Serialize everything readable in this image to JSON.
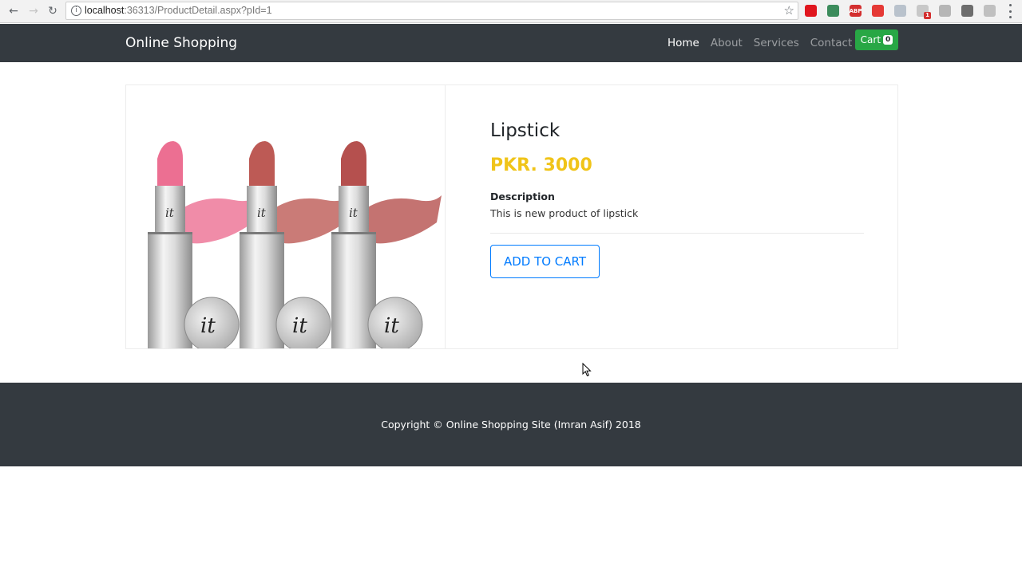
{
  "browser": {
    "url_host": "localhost",
    "url_rest": ":36313/ProductDetail.aspx?pId=1",
    "extensions": [
      {
        "name": "opera-icon",
        "color": "#e0161e"
      },
      {
        "name": "eyedropper-icon",
        "color": "#3c8c5c"
      },
      {
        "name": "adblock-icon",
        "color": "#d32f2f",
        "label": "ABP"
      },
      {
        "name": "video-icon",
        "color": "#e53935"
      },
      {
        "name": "dropbox-icon",
        "color": "#b9c2cc"
      },
      {
        "name": "extension-badge-icon",
        "color": "#c8c8c8",
        "badge": "1"
      },
      {
        "name": "angular-icon",
        "color": "#b6b6b6"
      },
      {
        "name": "a-icon",
        "color": "#6d6d6d"
      },
      {
        "name": "pdf-icon",
        "color": "#c0c0c0"
      }
    ]
  },
  "navbar": {
    "brand": "Online Shopping",
    "links": [
      {
        "label": "Home",
        "active": true
      },
      {
        "label": "About",
        "active": false
      },
      {
        "label": "Services",
        "active": false
      },
      {
        "label": "Contact",
        "active": false
      }
    ],
    "cart_label": "Cart",
    "cart_count": "0"
  },
  "product": {
    "name": "Lipstick",
    "price": "PKR. 3000",
    "description_label": "Description",
    "description": "This is new product of lipstick",
    "add_to_cart": "ADD TO CART",
    "image_logo_text": "it",
    "shades": [
      "#ec6f92",
      "#bd5a55",
      "#b5504e"
    ]
  },
  "footer": {
    "copyright": "Copyright © Online Shopping Site (Imran Asif) 2018"
  },
  "colors": {
    "navbar_bg": "#343a40",
    "price": "#f0c419",
    "primary": "#007bff",
    "cart_green": "#28a745"
  }
}
